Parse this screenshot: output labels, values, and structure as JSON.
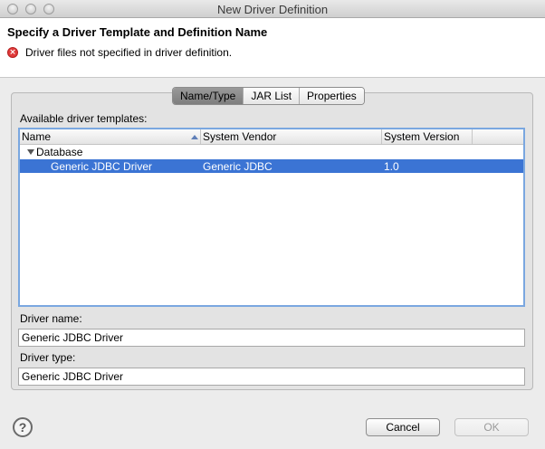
{
  "window": {
    "title": "New Driver Definition"
  },
  "header": {
    "title": "Specify a Driver Template and Definition Name",
    "error_message": "Driver files not specified in driver definition.",
    "error_icon": "error-circle-icon"
  },
  "tabs": [
    {
      "label": "Name/Type",
      "active": true
    },
    {
      "label": "JAR List",
      "active": false
    },
    {
      "label": "Properties",
      "active": false
    }
  ],
  "templates": {
    "label": "Available driver templates:",
    "columns": [
      "Name",
      "System Vendor",
      "System Version"
    ],
    "group": "Database",
    "rows": [
      {
        "name": "Generic JDBC Driver",
        "vendor": "Generic JDBC",
        "version": "1.0",
        "selected": true
      }
    ]
  },
  "driver_name": {
    "label": "Driver name:",
    "value": "Generic JDBC Driver"
  },
  "driver_type": {
    "label": "Driver type:",
    "value": "Generic JDBC Driver"
  },
  "buttons": {
    "cancel": "Cancel",
    "ok": "OK"
  },
  "colors": {
    "selection": "#3b74d4",
    "error": "#e03a3a",
    "focus_border": "#7aa7e0"
  }
}
